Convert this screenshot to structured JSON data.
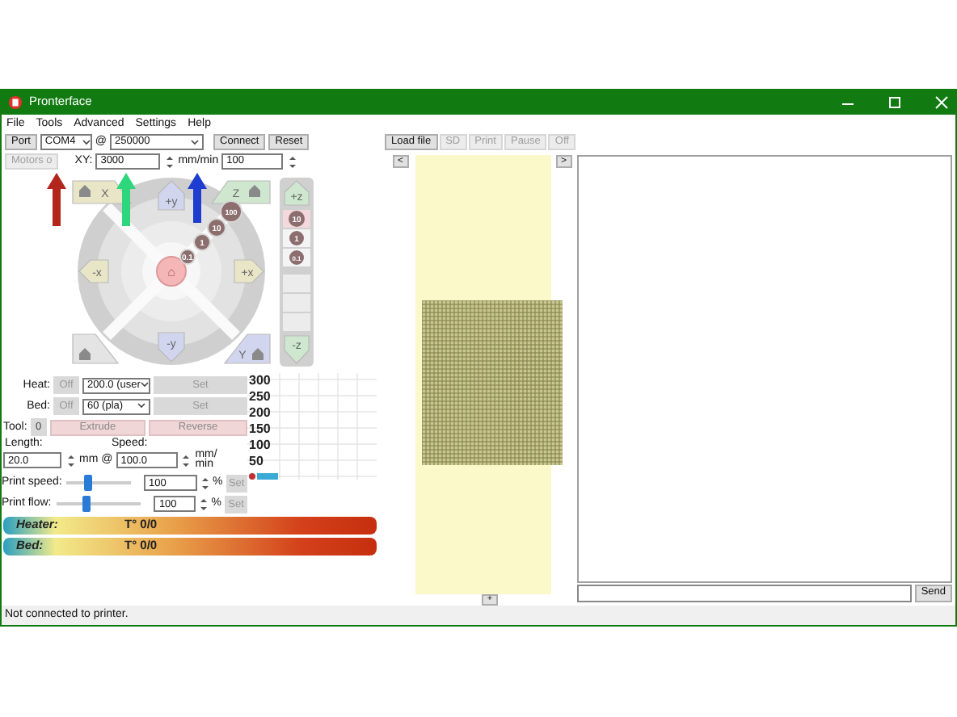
{
  "window": {
    "title": "Pronterface"
  },
  "menu": [
    "File",
    "Tools",
    "Advanced",
    "Settings",
    "Help"
  ],
  "connection": {
    "port_label": "Port",
    "port": "COM4",
    "at": "@",
    "baud": "250000",
    "connect": "Connect",
    "reset": "Reset"
  },
  "feed": {
    "motors": "Motors o",
    "xy_label": "XY:",
    "xy_value": "3000",
    "unit": "mm/min",
    "z_value": "100"
  },
  "jog": {
    "home_x": "X",
    "home_z": "Z",
    "home_y": "Y",
    "y_plus": "+y",
    "y_minus": "-y",
    "x_minus": "-x",
    "x_plus": "+x",
    "center": "⌂",
    "steps": [
      "100",
      "10",
      "1",
      "0.1"
    ],
    "z_plus": "+z",
    "z_minus": "-z",
    "z_steps": [
      "10",
      "1",
      "0.1"
    ]
  },
  "temps": [
    {
      "label": "Heat:",
      "off": "Off",
      "value": "200.0 (user",
      "set": "Set"
    },
    {
      "label": "Bed:",
      "off": "Off",
      "value": "60 (pla)",
      "set": "Set"
    }
  ],
  "tool": {
    "label": "Tool:",
    "value": "0",
    "extrude": "Extrude",
    "reverse": "Reverse"
  },
  "extrusion": {
    "length_label": "Length:",
    "length": "20.0",
    "mm_at": "mm @",
    "speed_label": "Speed:",
    "speed": "100.0",
    "unit": "mm/ min"
  },
  "sliders": [
    {
      "label": "Print speed:",
      "level": 0.33,
      "value": "100",
      "unit": "%",
      "set": "Set"
    },
    {
      "label": "Print flow:",
      "level": 0.35,
      "value": "100",
      "unit": "%",
      "set": "Set"
    }
  ],
  "graph": {
    "labels": [
      "300",
      "250",
      "200",
      "150",
      "100",
      "50"
    ]
  },
  "gauges": [
    {
      "label": "Heater:",
      "reading": "T° 0/0"
    },
    {
      "label": "Bed:",
      "reading": "T° 0/0"
    }
  ],
  "toolbar": [
    {
      "label": "Load file",
      "disabled": false
    },
    {
      "label": "SD",
      "disabled": true
    },
    {
      "label": "Print",
      "disabled": true
    },
    {
      "label": "Pause",
      "disabled": true
    },
    {
      "label": "Off",
      "disabled": true
    }
  ],
  "nav": {
    "left": "<",
    "right": ">",
    "plus": "+"
  },
  "console": {
    "send": "Send"
  },
  "status_bar": "Not connected to printer.",
  "annotations": [
    {
      "color": "#b3261c"
    },
    {
      "color": "#2ed67c"
    },
    {
      "color": "#1e3ccf"
    }
  ]
}
